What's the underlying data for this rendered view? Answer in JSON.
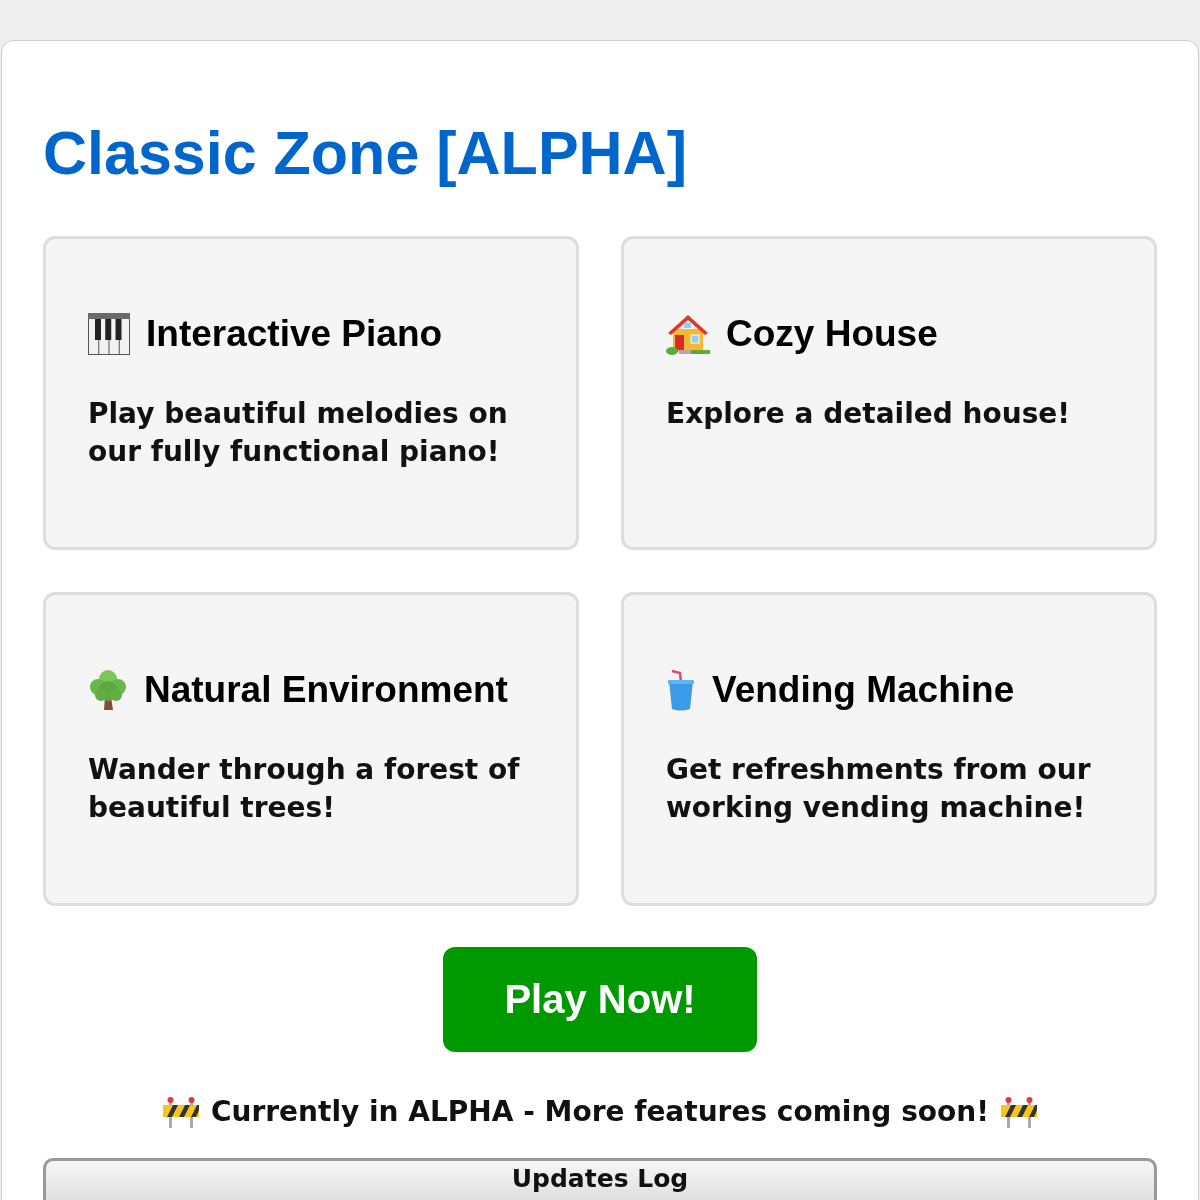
{
  "page": {
    "title": "Classic Zone [ALPHA]"
  },
  "cards": [
    {
      "kind": "piano",
      "title": "Interactive Piano",
      "description": "Play beautiful melodies on our fully functional piano!"
    },
    {
      "kind": "house",
      "title": "Cozy House",
      "description": "Explore a detailed house!"
    },
    {
      "kind": "tree",
      "title": "Natural Environment",
      "description": "Wander through a forest of beautiful trees!"
    },
    {
      "kind": "drink",
      "title": "Vending Machine",
      "description": "Get refreshments from our working vending machine!"
    }
  ],
  "play_button": {
    "label": "Play Now!"
  },
  "notice": {
    "text": "Currently in ALPHA - More features coming soon!"
  },
  "updates_log": {
    "label": "Updates Log"
  }
}
